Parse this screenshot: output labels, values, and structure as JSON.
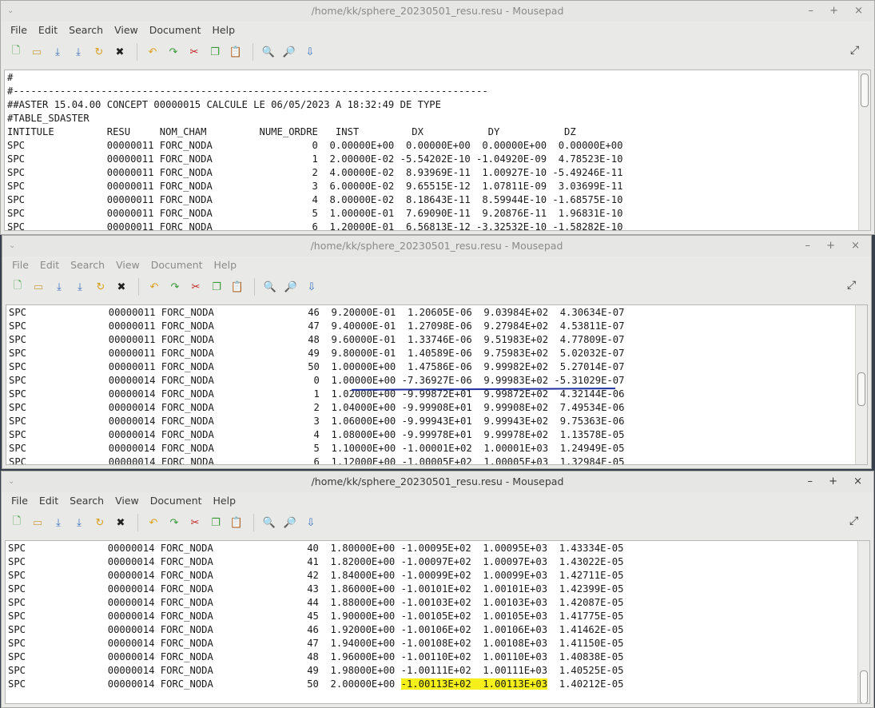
{
  "app": {
    "window_title": "/home/kk/sphere_20230501_resu.resu - Mousepad",
    "menus": [
      "File",
      "Edit",
      "Search",
      "View",
      "Document",
      "Help"
    ],
    "controls": "– + ×"
  },
  "icons": [
    "new-file-icon",
    "open-folder-icon",
    "save-icon",
    "save-as-icon",
    "reload-icon",
    "close-icon",
    "undo-icon",
    "redo-icon",
    "cut-icon",
    "copy-icon",
    "paste-icon",
    "find-icon",
    "find-replace-icon",
    "goto-icon",
    "fullscreen-icon"
  ],
  "window1": {
    "lines": [
      "#",
      "#---------------------------------------------------------------------------------",
      "##ASTER 15.04.00 CONCEPT 00000015 CALCULE LE 06/05/2023 A 18:32:49 DE TYPE",
      "#TABLE_SDASTER",
      "INTITULE         RESU     NOM_CHAM         NUME_ORDRE   INST         DX           DY           DZ",
      "SPC              00000011 FORC_NODA                 0  0.00000E+00  0.00000E+00  0.00000E+00  0.00000E+00",
      "SPC              00000011 FORC_NODA                 1  2.00000E-02 -5.54202E-10 -1.04920E-09  4.78523E-10",
      "SPC              00000011 FORC_NODA                 2  4.00000E-02  8.93969E-11  1.00927E-10 -5.49246E-11",
      "SPC              00000011 FORC_NODA                 3  6.00000E-02  9.65515E-12  1.07811E-09  3.03699E-11",
      "SPC              00000011 FORC_NODA                 4  8.00000E-02  8.18643E-11  8.59944E-10 -1.68575E-10",
      "SPC              00000011 FORC_NODA                 5  1.00000E-01  7.69090E-11  9.20876E-11  1.96831E-10",
      "SPC              00000011 FORC_NODA                 6  1.20000E-01  6.56813E-12 -3.32532E-10 -1.58282E-10"
    ]
  },
  "window2": {
    "lines": [
      "SPC              00000011 FORC_NODA                46  9.20000E-01  1.20605E-06  9.03984E+02  4.30634E-07",
      "SPC              00000011 FORC_NODA                47  9.40000E-01  1.27098E-06  9.27984E+02  4.53811E-07",
      "SPC              00000011 FORC_NODA                48  9.60000E-01  1.33746E-06  9.51983E+02  4.77809E-07",
      "SPC              00000011 FORC_NODA                49  9.80000E-01  1.40589E-06  9.75983E+02  5.02032E-07",
      "SPC              00000011 FORC_NODA                50  1.00000E+00  1.47586E-06  9.99982E+02  5.27014E-07",
      "SPC              00000014 FORC_NODA                 0  1.00000E+00 -7.36927E-06  9.99983E+02 -5.31029E-07",
      "SPC              00000014 FORC_NODA                 1  1.02000E+00 -9.99872E+01  9.99872E+02  4.32144E-06",
      "SPC              00000014 FORC_NODA                 2  1.04000E+00 -9.99908E+01  9.99908E+02  7.49534E-06",
      "SPC              00000014 FORC_NODA                 3  1.06000E+00 -9.99943E+01  9.99943E+02  9.75363E-06",
      "SPC              00000014 FORC_NODA                 4  1.08000E+00 -9.99978E+01  9.99978E+02  1.13578E-05",
      "SPC              00000014 FORC_NODA                 5  1.10000E+00 -1.00001E+02  1.00001E+03  1.24949E-05",
      "SPC              00000014 FORC_NODA                 6  1.12000E+00 -1.00005E+02  1.00005E+03  1.32984E-05"
    ]
  },
  "window3": {
    "lines": [
      "SPC              00000014 FORC_NODA                40  1.80000E+00 -1.00095E+02  1.00095E+03  1.43334E-05",
      "SPC              00000014 FORC_NODA                41  1.82000E+00 -1.00097E+02  1.00097E+03  1.43022E-05",
      "SPC              00000014 FORC_NODA                42  1.84000E+00 -1.00099E+02  1.00099E+03  1.42711E-05",
      "SPC              00000014 FORC_NODA                43  1.86000E+00 -1.00101E+02  1.00101E+03  1.42399E-05",
      "SPC              00000014 FORC_NODA                44  1.88000E+00 -1.00103E+02  1.00103E+03  1.42087E-05",
      "SPC              00000014 FORC_NODA                45  1.90000E+00 -1.00105E+02  1.00105E+03  1.41775E-05",
      "SPC              00000014 FORC_NODA                46  1.92000E+00 -1.00106E+02  1.00106E+03  1.41462E-05",
      "SPC              00000014 FORC_NODA                47  1.94000E+00 -1.00108E+02  1.00108E+03  1.41150E-05",
      "SPC              00000014 FORC_NODA                48  1.96000E+00 -1.00110E+02  1.00110E+03  1.40838E-05",
      "SPC              00000014 FORC_NODA                49  1.98000E+00 -1.00111E+02  1.00111E+03  1.40525E-05"
    ],
    "last_line": {
      "prefix": "SPC              00000014 FORC_NODA                50  2.00000E+00 ",
      "highlight": "-1.00113E+02  1.00113E+03",
      "suffix": "  1.40212E-05"
    }
  },
  "colors": {
    "highlight": "#f5ef1a",
    "annotation": "#2030a0"
  }
}
